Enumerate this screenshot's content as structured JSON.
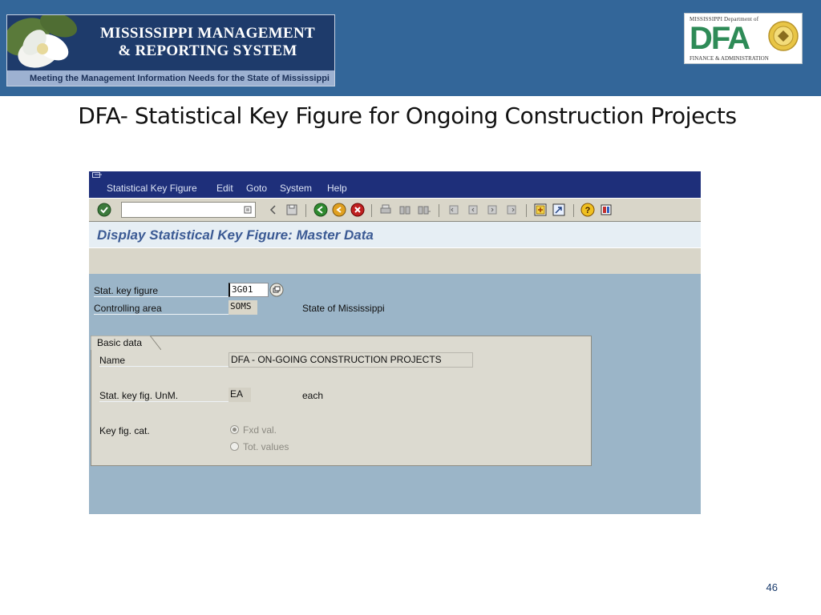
{
  "slide": {
    "logo": {
      "title_line1": "MISSISSIPPI MANAGEMENT",
      "title_line2": "& REPORTING SYSTEM",
      "tagline": "Meeting the Management Information Needs for the State of Mississippi"
    },
    "dfa_logo": {
      "top_text": "MISSISSIPPI Department of",
      "letters": "DFA",
      "bottom_text": "FINANCE & ADMINISTRATION"
    },
    "title": "DFA- Statistical Key Figure for Ongoing Construction Projects",
    "page_number": "46"
  },
  "sap": {
    "menu": [
      "Statistical Key Figure",
      "Edit",
      "Goto",
      "System",
      "Help"
    ],
    "toolbar": {
      "command_field_value": "",
      "buttons": [
        "enter-icon",
        "save-icon",
        "back-icon",
        "exit-icon",
        "cancel-icon",
        "print-icon",
        "find-icon",
        "find-next-icon",
        "first-page-icon",
        "previous-page-icon",
        "next-page-icon",
        "last-page-icon",
        "create-session-icon",
        "shortcut-icon",
        "help-icon",
        "customize-layout-icon"
      ]
    },
    "screen_title": "Display Statistical Key Figure: Master Data",
    "fields": {
      "stat_key_figure_label": "Stat. key figure",
      "stat_key_figure_value": "3G01",
      "controlling_area_label": "Controlling area",
      "controlling_area_value": "SOMS",
      "controlling_area_text": "State of Mississippi"
    },
    "basic_data": {
      "tab_label": "Basic data",
      "name_label": "Name",
      "name_value": "DFA - ON-GOING CONSTRUCTION PROJECTS",
      "unit_label": "Stat. key fig. UnM.",
      "unit_value": "EA",
      "unit_text": "each",
      "category_label": "Key fig. cat.",
      "category_options": [
        "Fxd val.",
        "Tot. values"
      ],
      "category_selected": "Fxd val."
    },
    "colors": {
      "menubar": "#1e2f7a",
      "body": "#9bb5c8",
      "title": "#3b5a94",
      "header_band": "#336699"
    }
  }
}
